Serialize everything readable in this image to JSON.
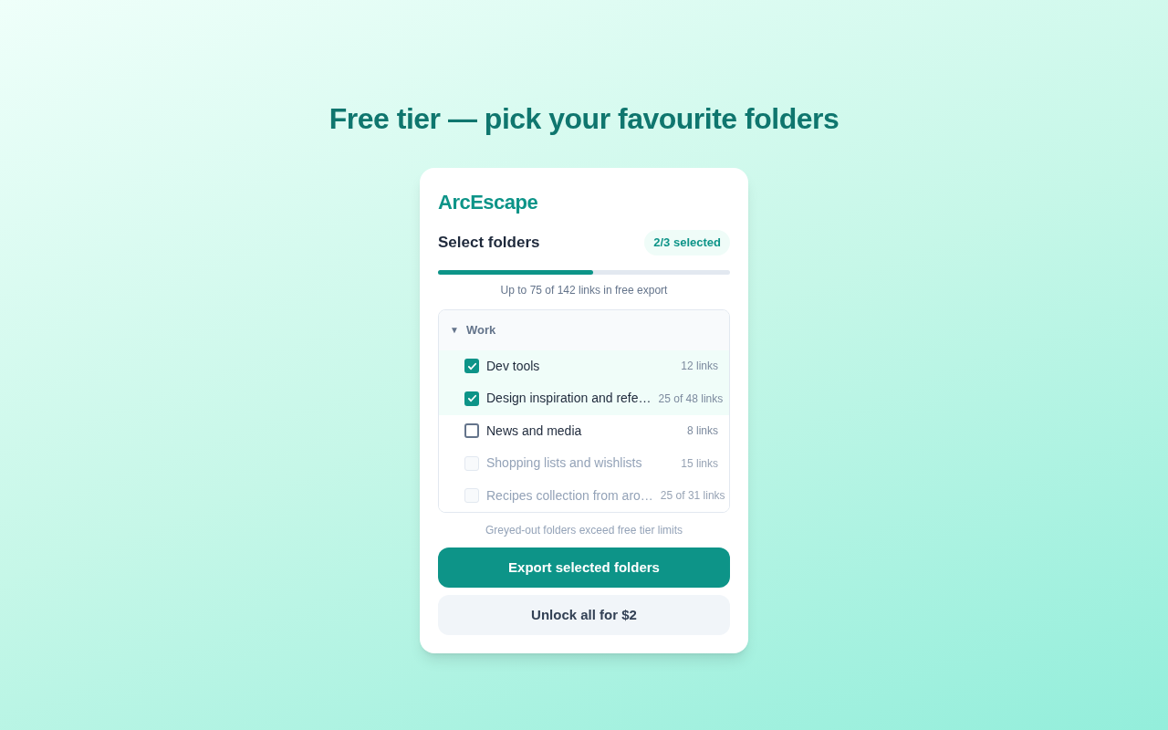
{
  "heading": "Free tier — pick your favourite folders",
  "card": {
    "brand": "ArcEscape",
    "section_title": "Select folders",
    "selected_badge": "2/3 selected",
    "progress": {
      "level": 0.53,
      "caption": "Up to 75 of 142 links in free export"
    },
    "group": {
      "toggle": "▼",
      "name": "Work",
      "expanded": true,
      "children": [
        {
          "name": "Dev tools",
          "count": "12 links",
          "checked": true,
          "disabled": false
        },
        {
          "name": "Design inspiration and refe…",
          "count": "25 of 48 links",
          "checked": true,
          "disabled": false
        },
        {
          "name": "News and media",
          "count": "8 links",
          "checked": false,
          "disabled": false
        },
        {
          "name": "Shopping lists and wishlists",
          "count": "15 links",
          "checked": false,
          "disabled": true
        },
        {
          "name": "Recipes collection from aro…",
          "count": "25 of 31 links",
          "checked": false,
          "disabled": true
        }
      ]
    },
    "note": "Greyed-out folders exceed free tier limits",
    "primary_button": "Export selected folders",
    "secondary_button": "Unlock all for $2"
  }
}
